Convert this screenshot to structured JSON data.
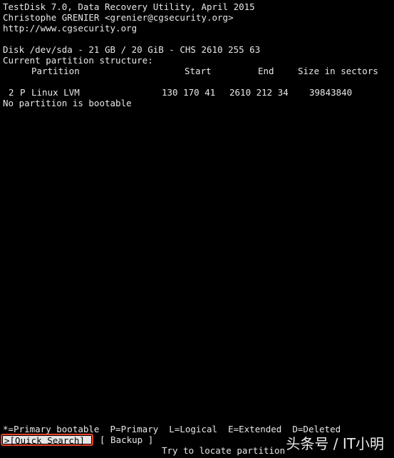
{
  "header": {
    "title": "TestDisk 7.0, Data Recovery Utility, April 2015",
    "author": "Christophe GRENIER <grenier@cgsecurity.org>",
    "url": "http://www.cgsecurity.org"
  },
  "disk": {
    "info": "Disk /dev/sda - 21 GB / 20 GiB - CHS 2610 255 63",
    "structure_label": "Current partition structure:"
  },
  "table": {
    "headers": {
      "partition": "Partition",
      "start": "Start",
      "end": "End",
      "size": "Size in sectors"
    },
    "rows": [
      {
        "num": "2",
        "type": "P",
        "fs": "Linux LVM",
        "start": "130 170 41",
        "end": "2610 212 34",
        "size": "39843840"
      }
    ]
  },
  "status": "No partition is bootable",
  "legend": "*=Primary bootable  P=Primary  L=Logical  E=Extended  D=Deleted",
  "menu": {
    "quick_search": ">[Quick Search]",
    "backup": "[ Backup ]",
    "hint": "Try to locate partition"
  },
  "watermark": "头条号 / IT小明"
}
